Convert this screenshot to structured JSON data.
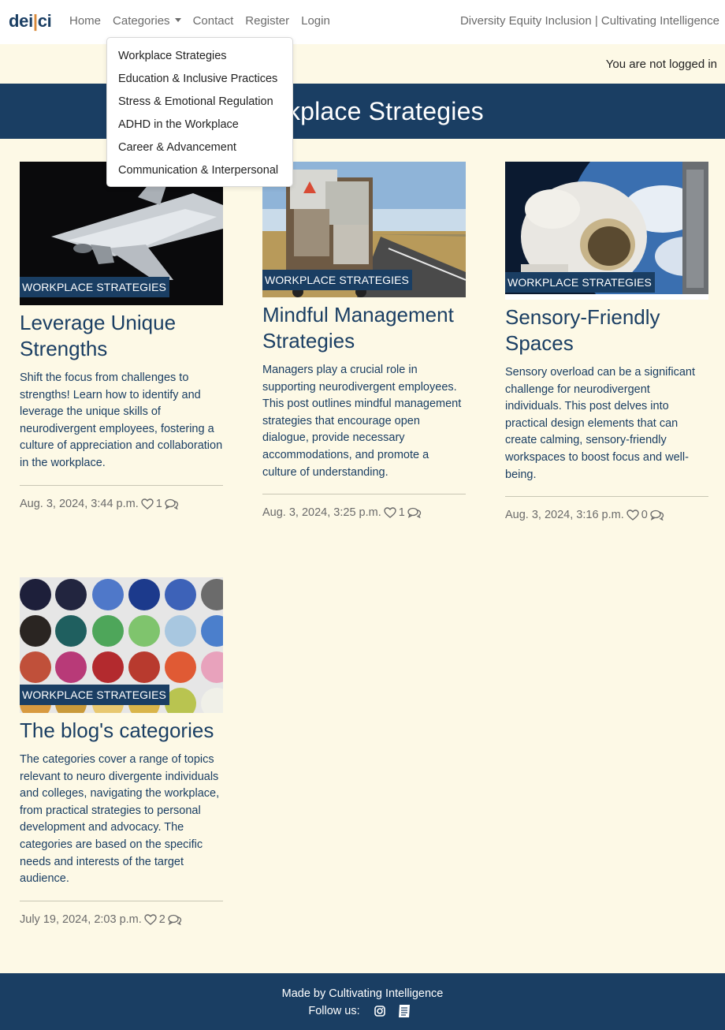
{
  "navbar": {
    "brand_left": "dei",
    "brand_sep": "|",
    "brand_right": "ci",
    "links": [
      "Home",
      "Categories",
      "Contact",
      "Register",
      "Login"
    ],
    "tagline": "Diversity Equity Inclusion | Cultivating Intelligence"
  },
  "dropdown": {
    "items": [
      "Workplace Strategies",
      "Education & Inclusive Practices",
      "Stress & Emotional Regulation",
      "ADHD in the Workplace",
      "Career & Advancement",
      "Communication & Interpersonal"
    ]
  },
  "status": {
    "login_text": "You are not logged in"
  },
  "banner": {
    "title": "Workplace Strategies"
  },
  "posts": [
    {
      "category": "WORKPLACE STRATEGIES",
      "title": "Leverage Unique Strengths",
      "excerpt": "Shift the focus from challenges to strengths! Learn how to identify and leverage the unique skills of neurodivergent employees, fostering a culture of appreciation and collaboration in the workplace.",
      "date": "Aug. 3, 2024, 3:44 p.m.",
      "likes": "1"
    },
    {
      "category": "WORKPLACE STRATEGIES",
      "title": "Mindful Management Strategies",
      "excerpt": "Managers play a crucial role in supporting neurodivergent employees. This post outlines mindful management strategies that encourage open dialogue, provide necessary accommodations, and promote a culture of understanding.",
      "date": "Aug. 3, 2024, 3:25 p.m.",
      "likes": "1"
    },
    {
      "category": "WORKPLACE STRATEGIES",
      "title": "Sensory-Friendly Spaces",
      "excerpt": "Sensory overload can be a significant challenge for neurodivergent individuals. This post delves into practical design elements that can create calming, sensory-friendly workspaces to boost focus and well-being.",
      "date": "Aug. 3, 2024, 3:16 p.m.",
      "likes": "0"
    },
    {
      "category": "WORKPLACE STRATEGIES",
      "title": "The blog's categories",
      "excerpt": "The categories cover a range of topics relevant to neuro divergente individuals and colleges, navigating the workplace, from practical strategies to personal development and advocacy. The categories are based on the specific needs and interests of the target audience.",
      "date": "July 19, 2024, 2:03 p.m.",
      "likes": "2"
    }
  ],
  "footer": {
    "made_by": "Made by Cultivating Intelligence",
    "follow": "Follow us:"
  },
  "colors": {
    "primary": "#1a3e63",
    "background": "#fdf9e6",
    "brand_accent": "#d9893a"
  },
  "icons": [
    "heart-icon",
    "comment-icon",
    "instagram-icon",
    "blog-icon"
  ]
}
